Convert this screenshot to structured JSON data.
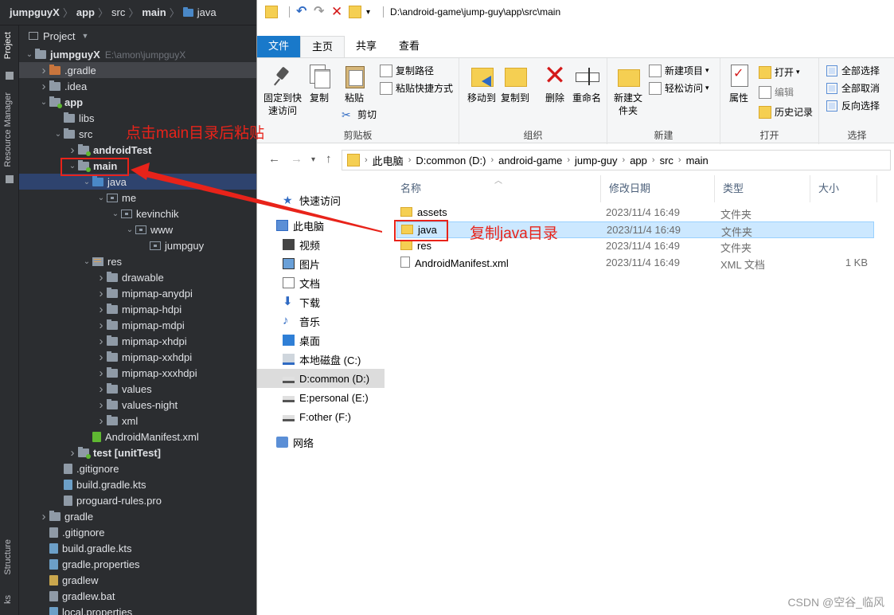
{
  "ide": {
    "breadcrumb": [
      "jumpguyX",
      "app",
      "src",
      "main",
      "java"
    ],
    "side_tabs": {
      "project": "Project",
      "resource_manager": "Resource Manager",
      "structure": "Structure",
      "bottom": "ks"
    },
    "panel_title": "Project",
    "tree": [
      {
        "label": "jumpguyX",
        "path": "E:\\amon\\jumpguyX",
        "depth": 0,
        "arrow": "down",
        "icon": "folder",
        "bold": true
      },
      {
        "label": ".gradle",
        "depth": 1,
        "arrow": "right",
        "icon": "folder-orange",
        "highlight": true
      },
      {
        "label": ".idea",
        "depth": 1,
        "arrow": "right",
        "icon": "folder"
      },
      {
        "label": "app",
        "depth": 1,
        "arrow": "down",
        "icon": "folder-green",
        "bold": true
      },
      {
        "label": "libs",
        "depth": 2,
        "arrow": "",
        "icon": "folder"
      },
      {
        "label": "src",
        "depth": 2,
        "arrow": "down",
        "icon": "folder"
      },
      {
        "label": "androidTest",
        "depth": 3,
        "arrow": "right",
        "icon": "folder-green",
        "bold": true
      },
      {
        "label": "main",
        "depth": 3,
        "arrow": "down",
        "icon": "folder-green",
        "bold": true
      },
      {
        "label": "java",
        "depth": 4,
        "arrow": "down",
        "icon": "folder-blue",
        "selected": true
      },
      {
        "label": "me",
        "depth": 5,
        "arrow": "down",
        "icon": "package"
      },
      {
        "label": "kevinchik",
        "depth": 6,
        "arrow": "down",
        "icon": "package"
      },
      {
        "label": "www",
        "depth": 7,
        "arrow": "down",
        "icon": "package"
      },
      {
        "label": "jumpguy",
        "depth": 8,
        "arrow": "",
        "icon": "package"
      },
      {
        "label": "res",
        "depth": 4,
        "arrow": "down",
        "icon": "res"
      },
      {
        "label": "drawable",
        "depth": 5,
        "arrow": "right",
        "icon": "folder"
      },
      {
        "label": "mipmap-anydpi",
        "depth": 5,
        "arrow": "right",
        "icon": "folder"
      },
      {
        "label": "mipmap-hdpi",
        "depth": 5,
        "arrow": "right",
        "icon": "folder"
      },
      {
        "label": "mipmap-mdpi",
        "depth": 5,
        "arrow": "right",
        "icon": "folder"
      },
      {
        "label": "mipmap-xhdpi",
        "depth": 5,
        "arrow": "right",
        "icon": "folder"
      },
      {
        "label": "mipmap-xxhdpi",
        "depth": 5,
        "arrow": "right",
        "icon": "folder"
      },
      {
        "label": "mipmap-xxxhdpi",
        "depth": 5,
        "arrow": "right",
        "icon": "folder"
      },
      {
        "label": "values",
        "depth": 5,
        "arrow": "right",
        "icon": "folder"
      },
      {
        "label": "values-night",
        "depth": 5,
        "arrow": "right",
        "icon": "folder"
      },
      {
        "label": "xml",
        "depth": 5,
        "arrow": "right",
        "icon": "folder"
      },
      {
        "label": "AndroidManifest.xml",
        "depth": 4,
        "arrow": "",
        "icon": "file-manifest"
      },
      {
        "label": "test [unitTest]",
        "depth": 3,
        "arrow": "right",
        "icon": "folder-green",
        "bold": true
      },
      {
        "label": ".gitignore",
        "depth": 2,
        "arrow": "",
        "icon": "file"
      },
      {
        "label": "build.gradle.kts",
        "depth": 2,
        "arrow": "",
        "icon": "file-gradle"
      },
      {
        "label": "proguard-rules.pro",
        "depth": 2,
        "arrow": "",
        "icon": "file"
      },
      {
        "label": "gradle",
        "depth": 1,
        "arrow": "right",
        "icon": "folder"
      },
      {
        "label": ".gitignore",
        "depth": 1,
        "arrow": "",
        "icon": "file"
      },
      {
        "label": "build.gradle.kts",
        "depth": 1,
        "arrow": "",
        "icon": "file-gradle"
      },
      {
        "label": "gradle.properties",
        "depth": 1,
        "arrow": "",
        "icon": "file-gradle"
      },
      {
        "label": "gradlew",
        "depth": 1,
        "arrow": "",
        "icon": "file-bat"
      },
      {
        "label": "gradlew.bat",
        "depth": 1,
        "arrow": "",
        "icon": "file"
      },
      {
        "label": "local.properties",
        "depth": 1,
        "arrow": "",
        "icon": "file-gradle"
      }
    ]
  },
  "explorer": {
    "title_path": "D:\\android-game\\jump-guy\\app\\src\\main",
    "tabs": [
      "文件",
      "主页",
      "共享",
      "查看"
    ],
    "ribbon": {
      "clipboard": {
        "pin": "固定到快速访问",
        "copy": "复制",
        "paste": "粘贴",
        "copy_path": "复制路径",
        "paste_shortcut": "粘贴快捷方式",
        "cut": "剪切",
        "group": "剪贴板"
      },
      "organize": {
        "move_to": "移动到",
        "copy_to": "复制到",
        "delete": "删除",
        "rename": "重命名",
        "group": "组织"
      },
      "new": {
        "new_folder": "新建文件夹",
        "new_item": "新建项目",
        "easy_access": "轻松访问",
        "group": "新建"
      },
      "open": {
        "properties": "属性",
        "open": "打开",
        "edit": "编辑",
        "history": "历史记录",
        "group": "打开"
      },
      "select": {
        "select_all": "全部选择",
        "select_none": "全部取消",
        "invert": "反向选择",
        "group": "选择"
      }
    },
    "address": [
      "此电脑",
      "D:common (D:)",
      "android-game",
      "jump-guy",
      "app",
      "src",
      "main"
    ],
    "nav": [
      {
        "label": "快速访问",
        "icon": "star",
        "indent": 1
      },
      {
        "label": "此电脑",
        "icon": "pc",
        "indent": 0
      },
      {
        "label": "视频",
        "icon": "video",
        "indent": 1
      },
      {
        "label": "图片",
        "icon": "picture",
        "indent": 1
      },
      {
        "label": "文档",
        "icon": "doc",
        "indent": 1
      },
      {
        "label": "下载",
        "icon": "download",
        "indent": 1
      },
      {
        "label": "音乐",
        "icon": "music",
        "indent": 1
      },
      {
        "label": "桌面",
        "icon": "desktop",
        "indent": 1
      },
      {
        "label": "本地磁盘 (C:)",
        "icon": "drive-c",
        "indent": 1
      },
      {
        "label": "D:common (D:)",
        "icon": "drive",
        "indent": 1,
        "selected": true
      },
      {
        "label": "E:personal (E:)",
        "icon": "drive",
        "indent": 1
      },
      {
        "label": "F:other (F:)",
        "icon": "drive",
        "indent": 1
      },
      {
        "label": "网络",
        "icon": "network",
        "indent": 0
      }
    ],
    "columns": {
      "name": "名称",
      "date": "修改日期",
      "type": "类型",
      "size": "大小"
    },
    "files": [
      {
        "name": "assets",
        "date": "2023/11/4 16:49",
        "type": "文件夹",
        "size": "",
        "icon": "folder"
      },
      {
        "name": "java",
        "date": "2023/11/4 16:49",
        "type": "文件夹",
        "size": "",
        "icon": "folder",
        "selected": true
      },
      {
        "name": "res",
        "date": "2023/11/4 16:49",
        "type": "文件夹",
        "size": "",
        "icon": "folder"
      },
      {
        "name": "AndroidManifest.xml",
        "date": "2023/11/4 16:49",
        "type": "XML 文档",
        "size": "1 KB",
        "icon": "xml"
      }
    ]
  },
  "annotations": {
    "paste_note": "点击main目录后粘贴",
    "copy_note": "复制java目录",
    "color": "#e8231a"
  },
  "watermark": "CSDN @空谷_临风"
}
